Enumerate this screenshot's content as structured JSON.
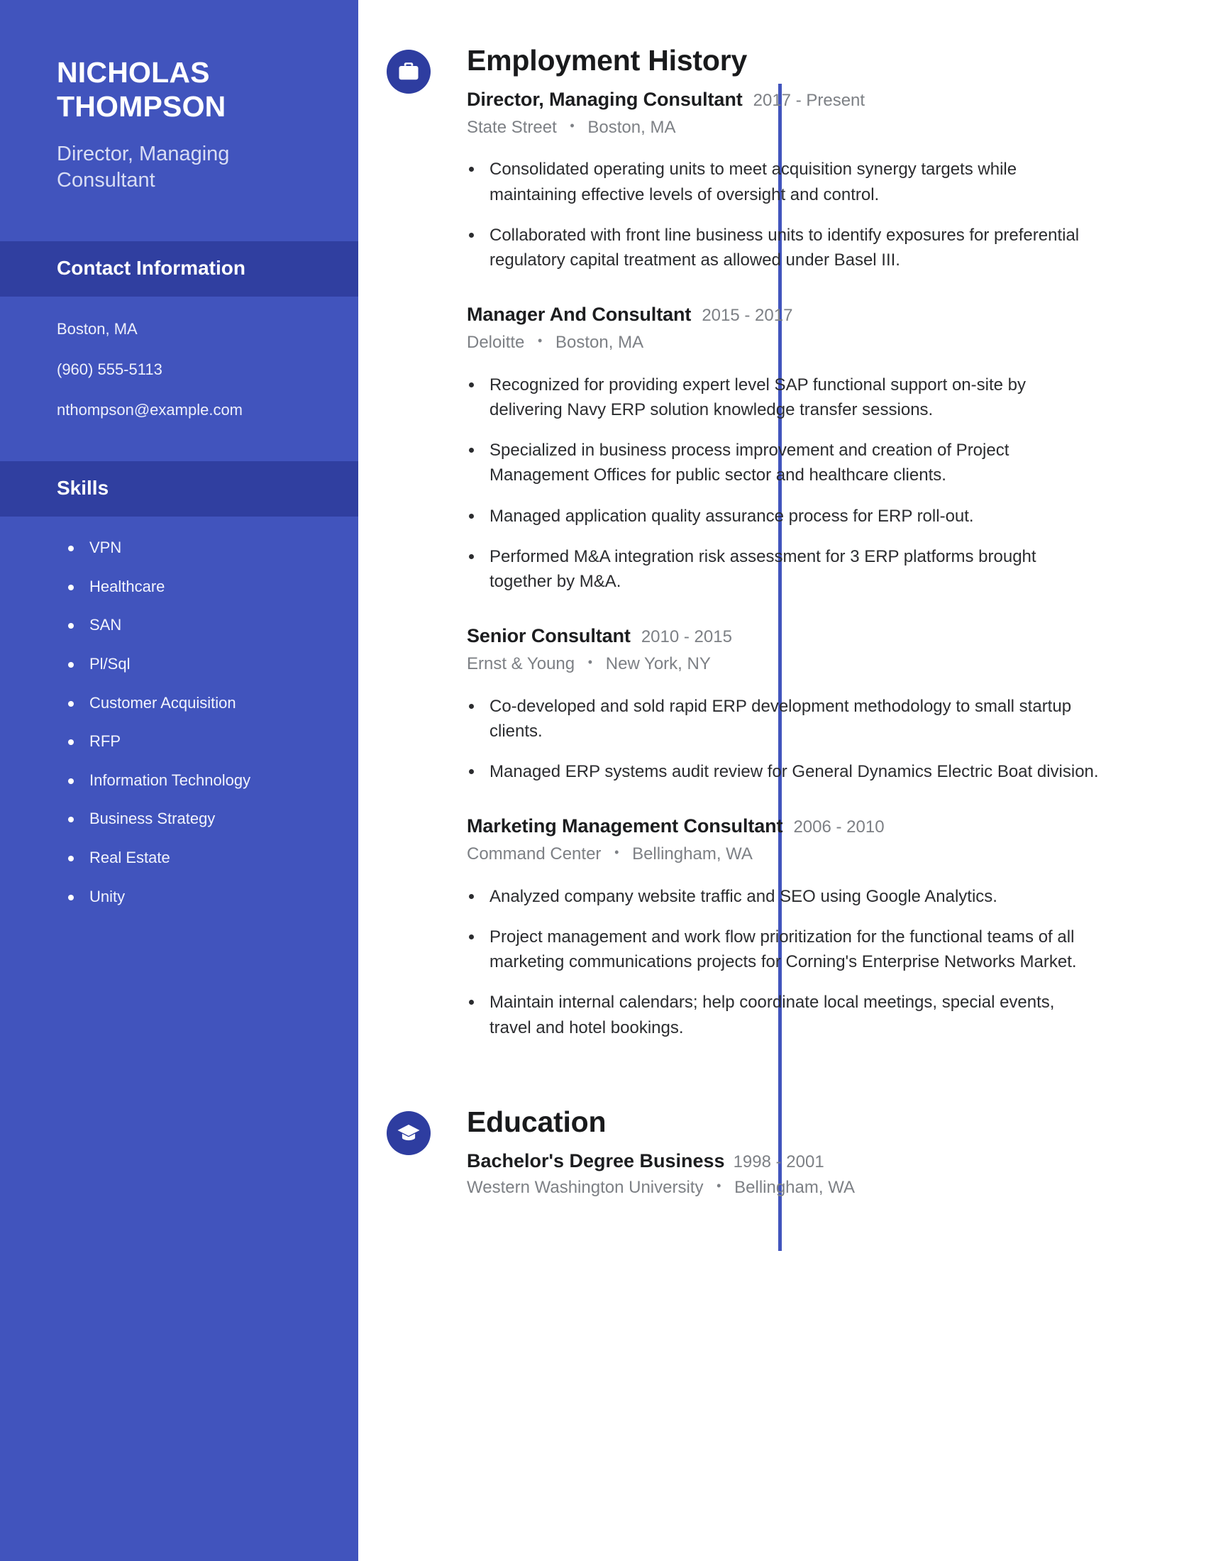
{
  "colors": {
    "sidebar_bg": "#4154bd",
    "sidebar_header_bg": "#303fa0",
    "accent": "#2e3da0",
    "timeline": "#4154bd",
    "body_text": "#2b2c2f",
    "muted_text": "#7d8085"
  },
  "sidebar": {
    "name": "NICHOLAS THOMPSON",
    "role": "Director, Managing Consultant",
    "contact_header": "Contact Information",
    "contact_items": [
      "Boston, MA",
      "(960) 555-5113",
      "nthompson@example.com"
    ],
    "skills_header": "Skills",
    "skills": [
      "VPN",
      "Healthcare",
      "SAN",
      "Pl/Sql",
      "Customer Acquisition",
      "RFP",
      "Information Technology",
      "Business Strategy",
      "Real Estate",
      "Unity"
    ]
  },
  "sections": {
    "employment": {
      "title": "Employment History",
      "icon": "briefcase-icon",
      "jobs": [
        {
          "title": "Director, Managing Consultant",
          "dates": "2017 - Present",
          "company": "State Street",
          "location": "Boston, MA",
          "bullets": [
            "Consolidated operating units to meet acquisition synergy targets while maintaining effective levels of oversight and control.",
            "Collaborated with front line business units to identify exposures for preferential regulatory capital treatment as allowed under Basel III."
          ]
        },
        {
          "title": "Manager And Consultant",
          "dates": "2015 - 2017",
          "company": "Deloitte",
          "location": "Boston, MA",
          "bullets": [
            "Recognized for providing expert level SAP functional support on-site by delivering Navy ERP solution knowledge transfer sessions.",
            "Specialized in business process improvement and creation of Project Management Offices for public sector and healthcare clients.",
            "Managed application quality assurance process for ERP roll-out.",
            "Performed M&A integration risk assessment for 3 ERP platforms brought together by M&A."
          ]
        },
        {
          "title": "Senior Consultant",
          "dates": "2010 - 2015",
          "company": "Ernst & Young",
          "location": "New York, NY",
          "bullets": [
            "Co-developed and sold rapid ERP development methodology to small startup clients.",
            "Managed ERP systems audit review for General Dynamics Electric Boat division."
          ]
        },
        {
          "title": "Marketing Management Consultant",
          "dates": "2006 - 2010",
          "company": "Command Center",
          "location": "Bellingham, WA",
          "bullets": [
            "Analyzed company website traffic and SEO using Google Analytics.",
            "Project management and work flow prioritization for the functional teams of all marketing communications projects for Corning's Enterprise Networks Market.",
            "Maintain internal calendars; help coordinate local meetings, special events, travel and hotel bookings."
          ]
        }
      ]
    },
    "education": {
      "title": "Education",
      "icon": "graduation-cap-icon",
      "entries": [
        {
          "degree": "Bachelor's Degree Business",
          "dates": "1998 - 2001",
          "school": "Western Washington University",
          "location": "Bellingham, WA"
        }
      ]
    }
  },
  "separator": "•"
}
